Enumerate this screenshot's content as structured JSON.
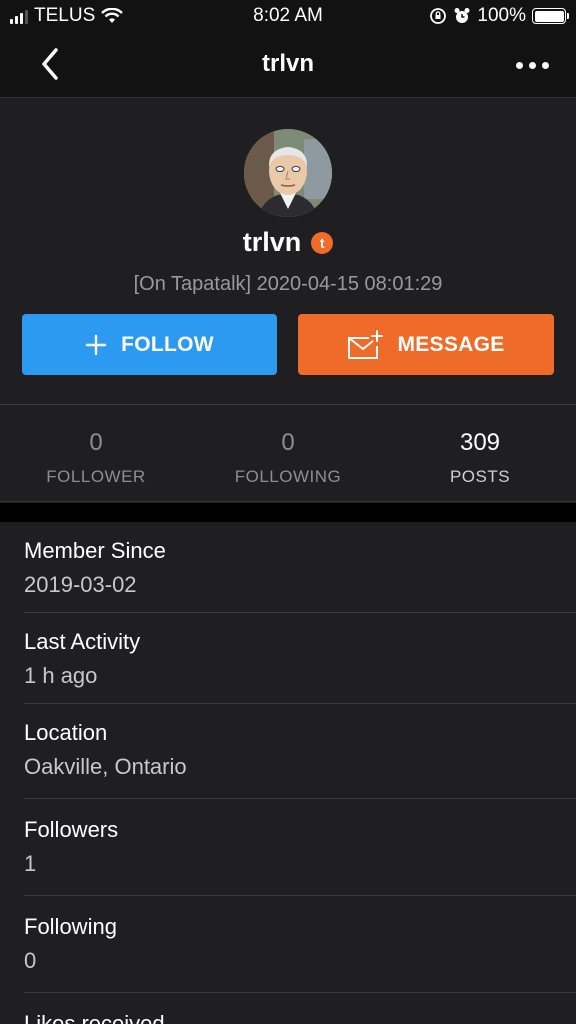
{
  "status_bar": {
    "carrier": "TELUS",
    "time": "8:02 AM",
    "battery": "100%"
  },
  "nav": {
    "title": "trlvn"
  },
  "profile": {
    "username": "trlvn",
    "badge": "t",
    "status": "[On Tapatalk] 2020-04-15 08:01:29",
    "follow_label": "FOLLOW",
    "message_label": "MESSAGE"
  },
  "stats": [
    {
      "value": "0",
      "label": "FOLLOWER"
    },
    {
      "value": "0",
      "label": "FOLLOWING"
    },
    {
      "value": "309",
      "label": "POSTS"
    }
  ],
  "info": [
    {
      "label": "Member Since",
      "value": "2019-03-02"
    },
    {
      "label": "Last Activity",
      "value": "1 h ago"
    },
    {
      "label": "Location",
      "value": "Oakville, Ontario"
    },
    {
      "label": "Followers",
      "value": "1"
    },
    {
      "label": "Following",
      "value": "0"
    },
    {
      "label": "Likes received",
      "value": ""
    }
  ],
  "colors": {
    "follow": "#2c9af0",
    "message": "#ee6b2a",
    "background": "#1f1f22"
  }
}
